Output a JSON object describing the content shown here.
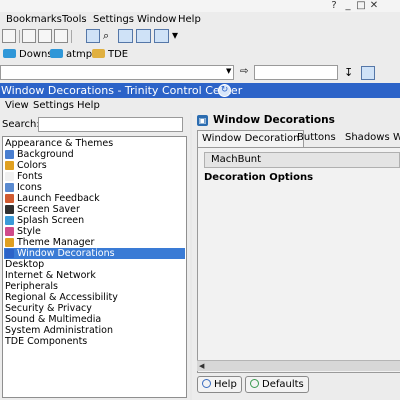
{
  "browser": {
    "window_controls": [
      "?",
      "_",
      "□",
      "✕"
    ],
    "menu": [
      "Bookmarks",
      "Tools",
      "Settings",
      "Window",
      "Help"
    ],
    "bookmarks": [
      "Downs",
      "atmp",
      "TDE"
    ]
  },
  "tcc": {
    "title": "Window Decorations - Trinity Control Center",
    "menu": [
      "View",
      "Settings",
      "Help"
    ],
    "search_label": "Search:",
    "search_value": "",
    "tree": [
      {
        "label": "Appearance & Themes",
        "indent": 0
      },
      {
        "label": "Background",
        "indent": 1,
        "icon": "background-icon",
        "color": "#4a7fd0"
      },
      {
        "label": "Colors",
        "indent": 1,
        "icon": "colors-icon",
        "color": "#e0a020"
      },
      {
        "label": "Fonts",
        "indent": 1,
        "icon": "fonts-icon",
        "color": "#f0f0f0"
      },
      {
        "label": "Icons",
        "indent": 1,
        "icon": "icons-icon",
        "color": "#5a8ad0"
      },
      {
        "label": "Launch Feedback",
        "indent": 1,
        "icon": "launch-feedback-icon",
        "color": "#d05a30"
      },
      {
        "label": "Screen Saver",
        "indent": 1,
        "icon": "screen-saver-icon",
        "color": "#303030"
      },
      {
        "label": "Splash Screen",
        "indent": 1,
        "icon": "splash-screen-icon",
        "color": "#3a9ad8"
      },
      {
        "label": "Style",
        "indent": 1,
        "icon": "style-icon",
        "color": "#d04a8a"
      },
      {
        "label": "Theme Manager",
        "indent": 1,
        "icon": "theme-manager-icon",
        "color": "#e0a020"
      },
      {
        "label": "Window Decorations",
        "indent": 1,
        "icon": "window-decorations-icon",
        "color": "#2c63c8",
        "selected": true
      },
      {
        "label": "Desktop",
        "indent": 0
      },
      {
        "label": "Internet & Network",
        "indent": 0
      },
      {
        "label": "Peripherals",
        "indent": 0
      },
      {
        "label": "Regional & Accessibility",
        "indent": 0
      },
      {
        "label": "Security & Privacy",
        "indent": 0
      },
      {
        "label": "Sound & Multimedia",
        "indent": 0
      },
      {
        "label": "System Administration",
        "indent": 0
      },
      {
        "label": "TDE Components",
        "indent": 0
      }
    ],
    "module": {
      "title": "Window Decorations",
      "tabs": [
        {
          "label": "Window Decoration",
          "active": true
        },
        {
          "label": "Buttons"
        },
        {
          "label": "Shadows"
        },
        {
          "label": "W"
        }
      ],
      "decoration_value": "MachBunt",
      "options_heading": "Decoration Options"
    },
    "buttons": {
      "help": "Help",
      "defaults": "Defaults"
    }
  },
  "colors": {
    "titlebar": "#2c63c8",
    "selection": "#3a7bd5"
  }
}
